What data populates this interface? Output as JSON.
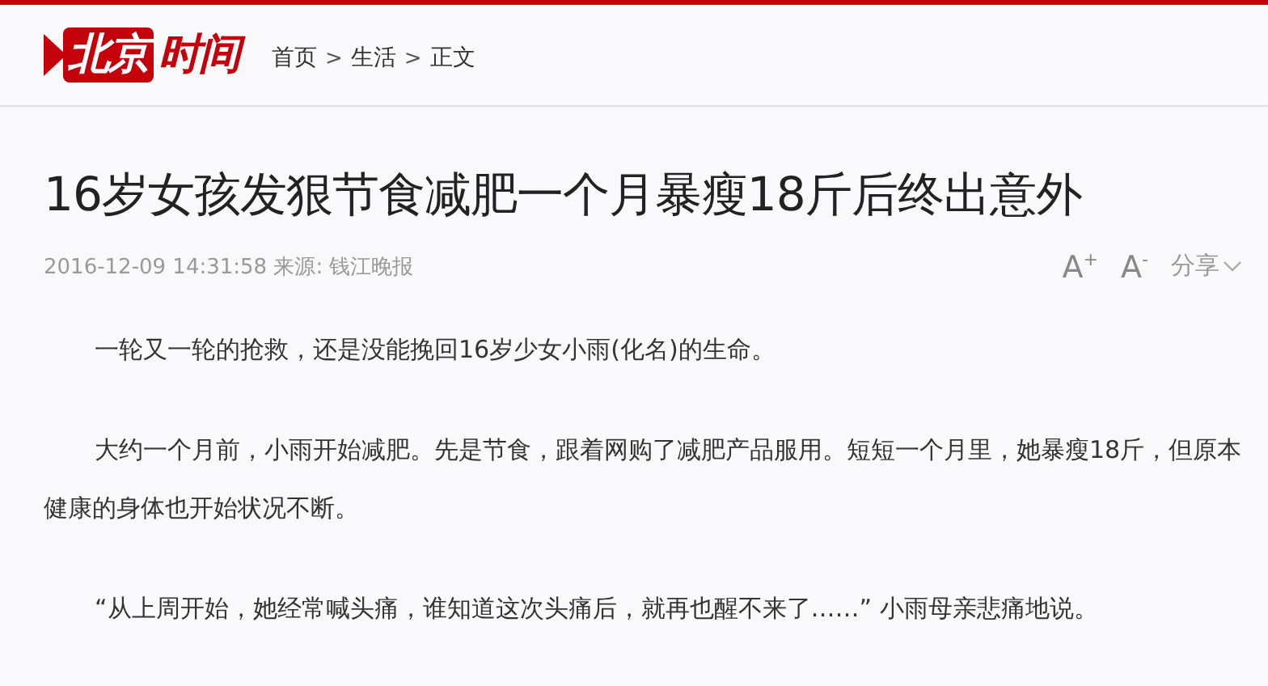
{
  "header": {
    "logo": {
      "part_1": "北京",
      "part_2": "时间"
    },
    "breadcrumb": {
      "separator": ">",
      "items": [
        "首页",
        "生活",
        "正文"
      ]
    }
  },
  "article": {
    "title": "16岁女孩发狠节食减肥一个月暴瘦18斤后终出意外",
    "meta": "2016-12-09 14:31:58 来源: 钱江晚报",
    "tools": [
      {
        "kind": "font",
        "label": "A$^{+}$"
      },
      {
        "kind": "font",
        "label": "A$^{-}$"
      },
      {
        "kind": "share",
        "label": "分享"
      }
    ],
    "paragraphs": [
      "一轮又一轮的抢救，还是没能挽回16岁少女小雨(化名)的生命。",
      "大约一个月前，小雨开始减肥。先是节食，跟着网购了减肥产品服用。短短一个月里，她暴瘦18斤，但原本健康的身体也开始状况不断。",
      "“从上周开始，她经常喊头痛，谁知道这次头痛后，就再也醒不来了……” 小雨母亲悲痛地说。"
    ]
  }
}
